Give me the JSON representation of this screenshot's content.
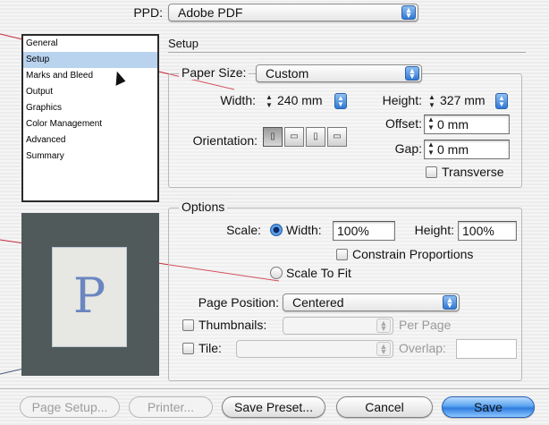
{
  "ppd": {
    "label": "PPD:",
    "value": "Adobe PDF"
  },
  "sidebar": {
    "items": [
      {
        "label": "General"
      },
      {
        "label": "Setup",
        "selected": true
      },
      {
        "label": "Marks and Bleed"
      },
      {
        "label": "Output"
      },
      {
        "label": "Graphics"
      },
      {
        "label": "Color Management"
      },
      {
        "label": "Advanced"
      },
      {
        "label": "Summary"
      }
    ]
  },
  "preview": {
    "glyph": "P"
  },
  "setup": {
    "title": "Setup",
    "paper_size": {
      "label": "Paper Size:",
      "value": "Custom"
    },
    "width": {
      "label": "Width:",
      "value": "240 mm"
    },
    "height": {
      "label": "Height:",
      "value": "327 mm"
    },
    "offset": {
      "label": "Offset:",
      "value": "0 mm"
    },
    "gap": {
      "label": "Gap:",
      "value": "0 mm"
    },
    "orientation": {
      "label": "Orientation:",
      "selected_index": 0
    },
    "transverse": {
      "label": "Transverse",
      "checked": false
    }
  },
  "options": {
    "title": "Options",
    "scale": {
      "label": "Scale:",
      "width_label": "Width:",
      "width_value": "100%",
      "height_label": "Height:",
      "height_value": "100%",
      "constrain_label": "Constrain Proportions",
      "scale_to_fit_label": "Scale To Fit",
      "selected": "width"
    },
    "page_position": {
      "label": "Page Position:",
      "value": "Centered"
    },
    "thumbnails": {
      "label": "Thumbnails:",
      "per_page_label": "Per Page"
    },
    "tile": {
      "label": "Tile:",
      "overlap_label": "Overlap:"
    }
  },
  "buttons": {
    "page_setup": "Page Setup...",
    "printer": "Printer...",
    "save_preset": "Save Preset...",
    "cancel": "Cancel",
    "save": "Save"
  },
  "colors": {
    "accent": "#2f79d6",
    "selection": "#b9d2ee",
    "preview_bg": "#505a5a",
    "callout_line": "#c8283a"
  }
}
